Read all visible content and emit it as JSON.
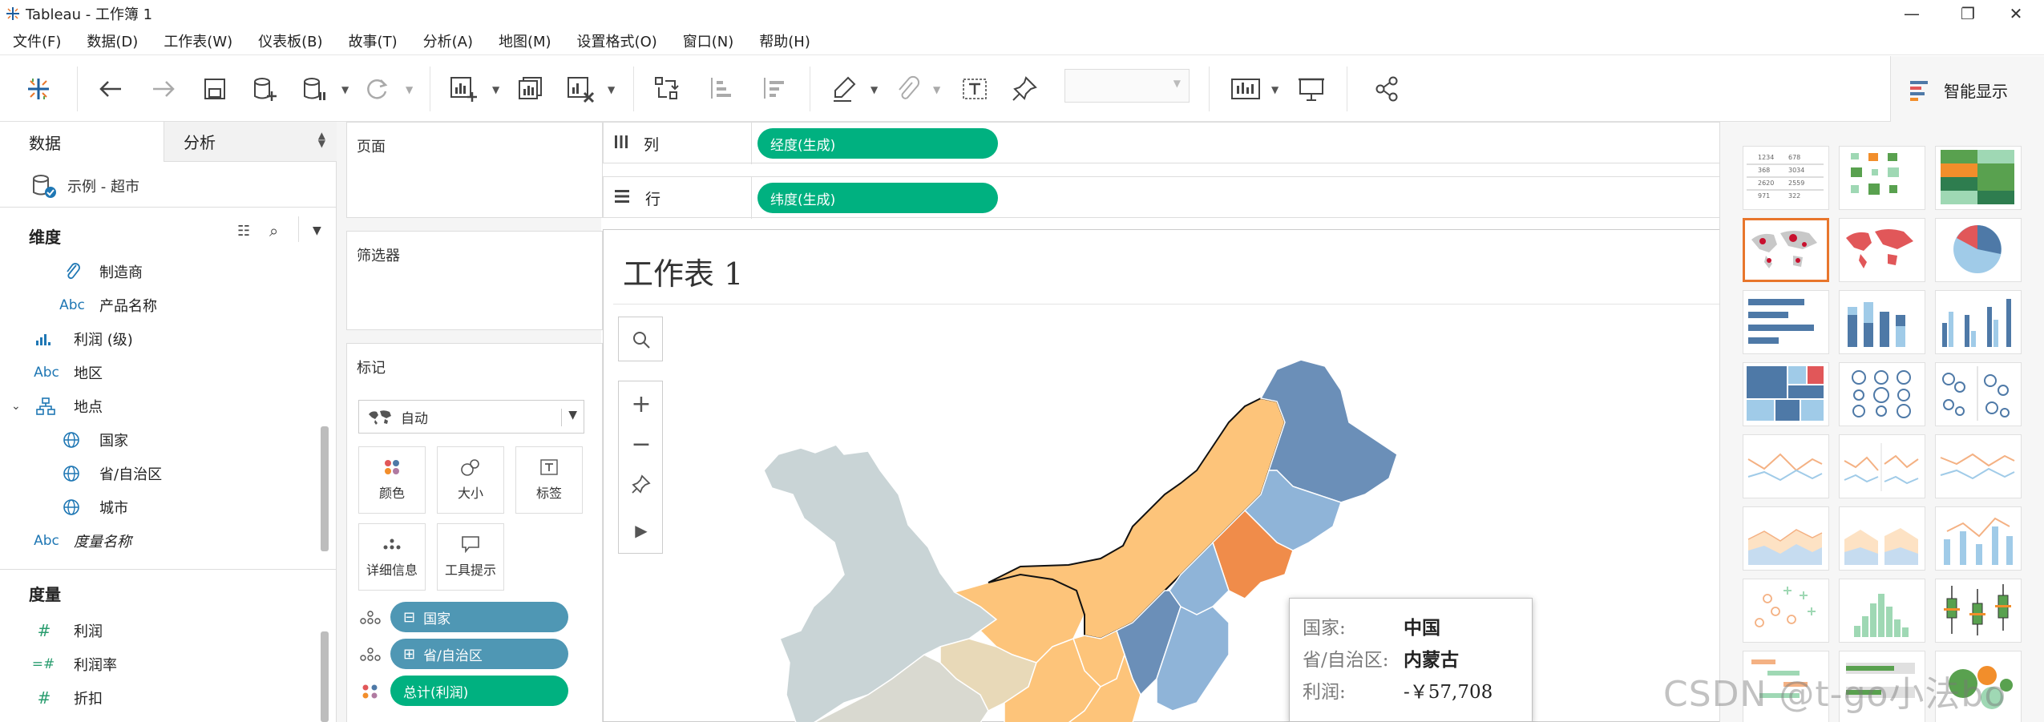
{
  "window": {
    "title": "Tableau - 工作簿 1"
  },
  "menu": [
    "文件(F)",
    "数据(D)",
    "工作表(W)",
    "仪表板(B)",
    "故事(T)",
    "分析(A)",
    "地图(M)",
    "设置格式(O)",
    "窗口(N)",
    "帮助(H)"
  ],
  "toolbar": {
    "smart_show_label": "智能显示"
  },
  "data_pane": {
    "tabs": [
      "数据",
      "分析"
    ],
    "datasource": "示例 - 超市",
    "dimensions_title": "维度",
    "measures_title": "度量",
    "dimensions": [
      {
        "icon": "paperclip-icon",
        "glyph": "🔗",
        "label": "制造商",
        "indent": 2
      },
      {
        "icon": "abc-icon",
        "glyph": "Abc",
        "label": "产品名称",
        "indent": 2
      },
      {
        "icon": "bin-histogram-icon",
        "glyph": "ılı",
        "label": "利润 (级)",
        "indent": 1
      },
      {
        "icon": "abc-icon",
        "glyph": "Abc",
        "label": "地区",
        "indent": 1
      },
      {
        "icon": "hierarchy-icon",
        "glyph": "品",
        "label": "地点",
        "indent": 1
      },
      {
        "icon": "globe-icon",
        "glyph": "⊕",
        "label": "国家",
        "indent": 2
      },
      {
        "icon": "globe-icon",
        "glyph": "⊕",
        "label": "省/自治区",
        "indent": 2
      },
      {
        "icon": "globe-icon",
        "glyph": "⊕",
        "label": "城市",
        "indent": 2
      },
      {
        "icon": "abc-icon",
        "glyph": "Abc",
        "label": "度量名称",
        "indent": 1,
        "italic": true
      }
    ],
    "measures": [
      {
        "icon": "number-icon",
        "glyph": "#",
        "label": "利润"
      },
      {
        "icon": "calc-number-icon",
        "glyph": "=#",
        "label": "利润率"
      },
      {
        "icon": "number-icon",
        "glyph": "#",
        "label": "折扣"
      }
    ]
  },
  "cards": {
    "pages_title": "页面",
    "filters_title": "筛选器",
    "marks_title": "标记",
    "marks_type": "自动",
    "mark_buttons": [
      "颜色",
      "大小",
      "标签",
      "详细信息",
      "工具提示"
    ],
    "mark_pills": [
      {
        "label": "国家",
        "prefix": "⊟",
        "color": "blue"
      },
      {
        "label": "省/自治区",
        "prefix": "⊞",
        "color": "blue"
      },
      {
        "label": "总计(利润)",
        "prefix": "",
        "color": "green"
      }
    ]
  },
  "shelves": {
    "columns_label": "列",
    "columns_pill": "经度(生成)",
    "rows_label": "行",
    "rows_pill": "纬度(生成)"
  },
  "viz": {
    "title": "工作表 1"
  },
  "tooltip": {
    "rows": [
      {
        "key": "国家:",
        "value": "中国"
      },
      {
        "key": "省/自治区:",
        "value": "内蒙古"
      },
      {
        "key": "利润:",
        "value": "-￥57,708"
      }
    ]
  },
  "show_me": {
    "selected_index": 3
  },
  "colors": {
    "accent_green": "#00b180",
    "pill_blue": "#4f97b4",
    "selected_border": "#e8762c",
    "map_orange_light": "#fdc47a",
    "map_orange_dark": "#f08c4a",
    "map_blue_dark": "#6b8fb8",
    "map_blue_light": "#8fb4d8",
    "map_gray": "#c9d4d6"
  },
  "watermark": "CSDN @t-go小法bo"
}
